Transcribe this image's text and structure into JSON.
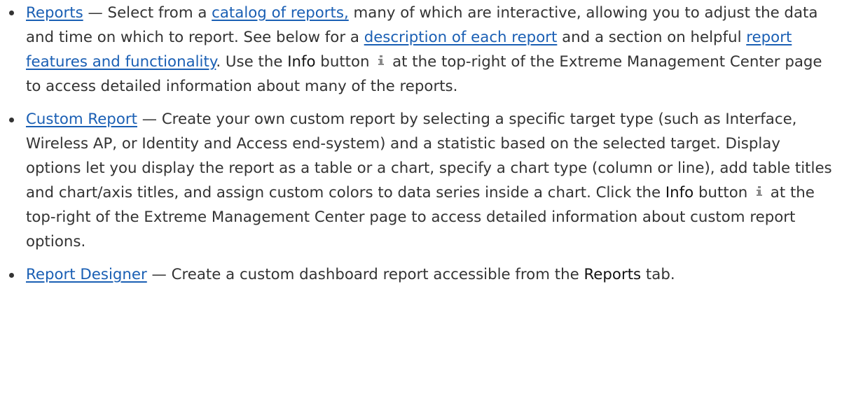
{
  "items": [
    {
      "link": "Reports",
      "dash": " — ",
      "p1": "Select from a ",
      "link2": "catalog of reports,",
      "p2": " many of which are interactive, allowing you to adjust the data and time on which to report. See below for a ",
      "link3": "description of each report",
      "p3": " and a section on helpful ",
      "link4": "report features and functionality",
      "p4": ". Use the ",
      "strong": "Info",
      "p5": " button ",
      "icon": "info-icon",
      "p6": " at the top-right of the Extreme Management Center page to access detailed information about many of the reports."
    },
    {
      "link": "Custom Report",
      "dash": " — ",
      "p1": "Create your own custom report by selecting a specific target type (such as Interface, Wireless AP, or Identity and Access end-system) and a statistic based on the selected target. Display options let you display the report as a table or a chart, specify a chart type (column or line), add table titles and chart/axis titles, and assign custom colors to data series inside a chart. Click the ",
      "strong": "Info",
      "p2": " button ",
      "icon": "info-icon",
      "p3": " at the top-right of the Extreme Management Center page to access detailed information about custom report options."
    },
    {
      "link": "Report Designer",
      "dash": " — ",
      "p1": "Create a custom dashboard report accessible from the ",
      "strong": "Reports",
      "p2": " tab."
    }
  ],
  "colors": {
    "text": "#333333",
    "link": "#1a5fb4",
    "icon": "#8a8a8a"
  }
}
